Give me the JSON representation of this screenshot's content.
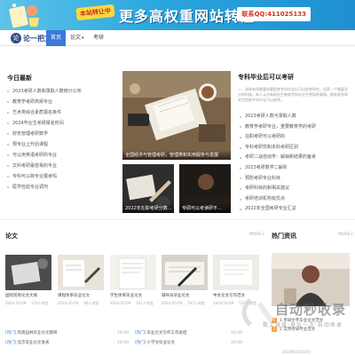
{
  "banner": {
    "tag": "本站转让中",
    "title": "更多高权重网站转让",
    "contact": "联系QQ:411025133"
  },
  "nav": {
    "logo_mark": "论",
    "logo_text": "论一把文网",
    "items": [
      {
        "label": "首页",
        "active": true
      },
      {
        "label": "论文",
        "has_caret": true
      },
      {
        "label": "考研"
      }
    ]
  },
  "latest": {
    "title": "今日最新",
    "items": [
      "2023考研人数和录取人数统计公布",
      "教育学考研高频专业",
      "艺术类综合素质报名条件",
      "2024毕业生考研报名时间",
      "财务管理考研数学",
      "预专业上升后课程",
      "可以用英语考研的专业",
      "文科考研最容易的专业",
      "专科可以跨专业报考吗",
      "医学检验专业调剂"
    ]
  },
  "featured": {
    "big_caption": "全国经济与管理考研，管理类和实用服务与发展",
    "small_captions": [
      "2022年在职考研分数…",
      "专硕可以考读研不…"
    ]
  },
  "right": {
    "title": "专科毕业后可以考研",
    "desc": "一、选择有所需要的要报考专科毕业后可以报考研究，但是一个需要学分的时候，有人认为有研究生教育专科毕业生考研的事情，都有很多研究生招收专科毕业可以报考。",
    "items": [
      "2023考研人数与录取人数",
      "教育学考研专业，重要教育学的考研",
      "在职考研可以考研的",
      "专科考研究和本科考研区别",
      "考研二战自动学：解锁新结果的备考",
      "2023考研数学二解析",
      "预防考研专业科目",
      "考研科目的和相关建议",
      "考研培训机构有优点",
      "2022年全国考研专业汇总"
    ]
  },
  "papers": {
    "title": "论文",
    "more": "MORE+",
    "cards": [
      {
        "title": "国际贸易论文大纲",
        "date": "2024-10-09",
        "views": "274人浏览"
      },
      {
        "title": "课程体系毕业论文",
        "date": "2024-10-09",
        "views": "90人浏览"
      },
      {
        "title": "学生体育毕业论文",
        "date": "2024-10-09",
        "views": "101人浏览"
      },
      {
        "title": "辅导员毕业论文",
        "date": "2024-10-09",
        "views": "197人浏览"
      },
      {
        "title": "中文论文写作范文",
        "date": "2024-10-09",
        "views": "110人浏览"
      }
    ],
    "list": [
      {
        "tag": "[热门]",
        "text": "风景园林毕业论文题目",
        "date": "10-09"
      },
      {
        "tag": "[热门]",
        "text": "北京毕业论文发表",
        "date": "10-09"
      }
    ],
    "list2": [
      {
        "tag": "[热门]",
        "text": "毕业论文写作工作总结",
        "date": "10-09"
      },
      {
        "tag": "[热门]",
        "text": "小学文毕业论文",
        "date": "10-09"
      }
    ]
  },
  "hot": {
    "title": "热门资讯",
    "more": "MORE+",
    "items": [
      "1 考研文字毕业论文范文",
      "2 实用考研专业范文"
    ],
    "date": "2024年10月10日"
  },
  "watermark": {
    "text": "自动秒收录",
    "sub": "数上链接·来访一次·自动收录"
  },
  "colors": {
    "accent": "#3b7ad9",
    "banner": "#2aa6dd",
    "hot_badge": "#f0a23a"
  }
}
